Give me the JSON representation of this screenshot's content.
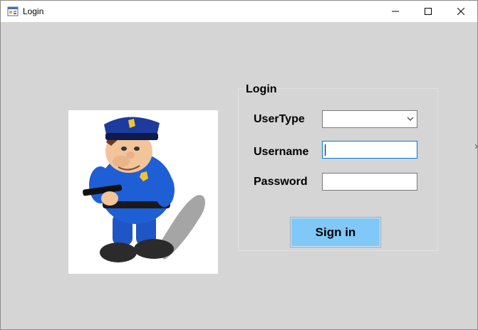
{
  "window": {
    "title": "Login",
    "controls": [
      "minimize-icon",
      "maximize-icon",
      "close-icon"
    ]
  },
  "picture": {
    "icon": "police-officer-cartoon"
  },
  "login_group": {
    "title": "Login",
    "usertype_label": "UserType",
    "usertype_value": "",
    "username_label": "Username",
    "username_value": "",
    "password_label": "Password",
    "password_value": "",
    "signin_label": "Sign in"
  },
  "colors": {
    "client_bg": "#d5d5d5",
    "titlebar_bg": "#ffffff",
    "signin_bg": "#7fc8f8",
    "focus_border": "#0078d7"
  }
}
